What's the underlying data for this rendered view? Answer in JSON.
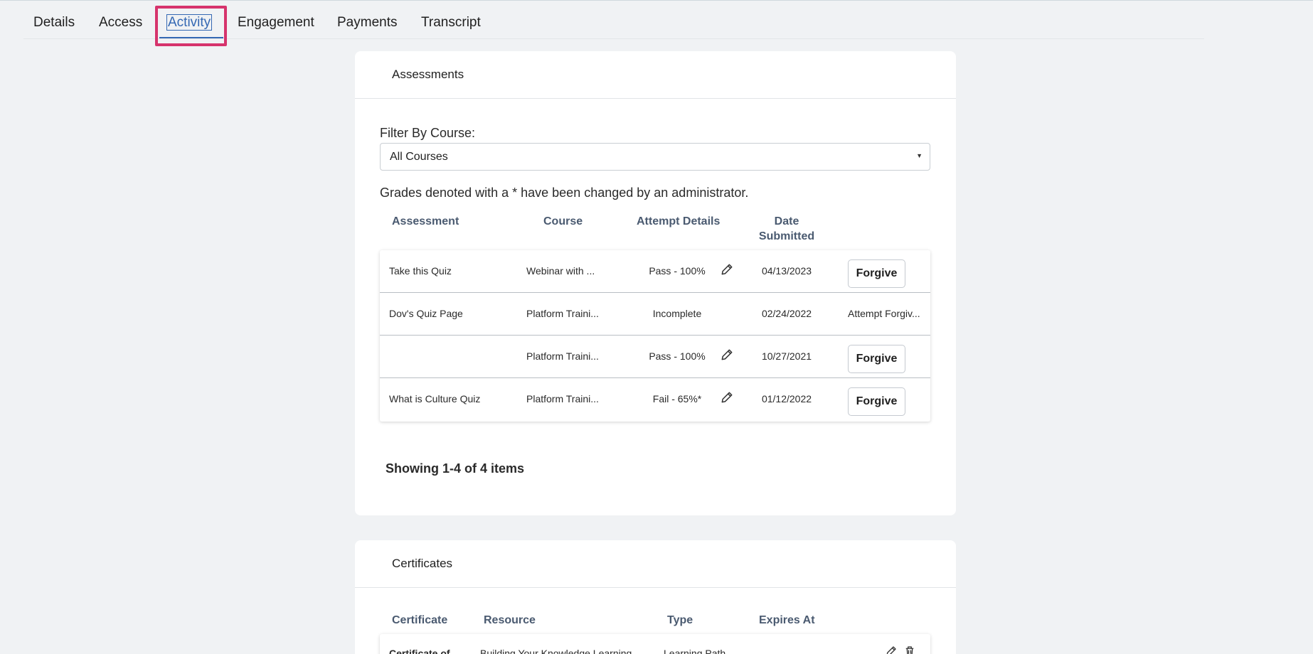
{
  "tabs": [
    {
      "label": "Details"
    },
    {
      "label": "Access"
    },
    {
      "label": "Activity"
    },
    {
      "label": "Engagement"
    },
    {
      "label": "Payments"
    },
    {
      "label": "Transcript"
    }
  ],
  "active_tab": "Activity",
  "assessments": {
    "title": "Assessments",
    "filter_label": "Filter By Course:",
    "filter_value": "All Courses",
    "note": "Grades denoted with a * have been changed by an administrator.",
    "columns": {
      "assessment": "Assessment",
      "course": "Course",
      "attempt": "Attempt Details",
      "date_line1": "Date",
      "date_line2": "Submitted"
    },
    "rows": [
      {
        "assessment": "Take this Quiz",
        "course": "Webinar with ...",
        "attempt": "Pass - 100%",
        "date": "04/13/2023",
        "action": "Forgive"
      },
      {
        "assessment": "Dov's Quiz Page",
        "course": "Platform Traini...",
        "attempt": "Incomplete",
        "date": "02/24/2022",
        "status": "Attempt Forgiv..."
      },
      {
        "assessment": "",
        "course": "Platform Traini...",
        "attempt": "Pass - 100%",
        "date": "10/27/2021",
        "action": "Forgive"
      },
      {
        "assessment": "What is Culture Quiz",
        "course": "Platform Traini...",
        "attempt": "Fail - 65%*",
        "date": "01/12/2022",
        "action": "Forgive"
      }
    ],
    "showing": "Showing 1-4 of 4 items"
  },
  "certificates": {
    "title": "Certificates",
    "columns": {
      "certificate": "Certificate",
      "resource": "Resource",
      "type": "Type",
      "expires": "Expires At"
    },
    "rows": [
      {
        "certificate": "Certificate of",
        "resource": "Building Your Knowledge Learning",
        "type": "Learning Path"
      }
    ]
  },
  "colors": {
    "accent": "#3468b3",
    "highlight": "#d6336c",
    "background": "#f0f2f4"
  }
}
